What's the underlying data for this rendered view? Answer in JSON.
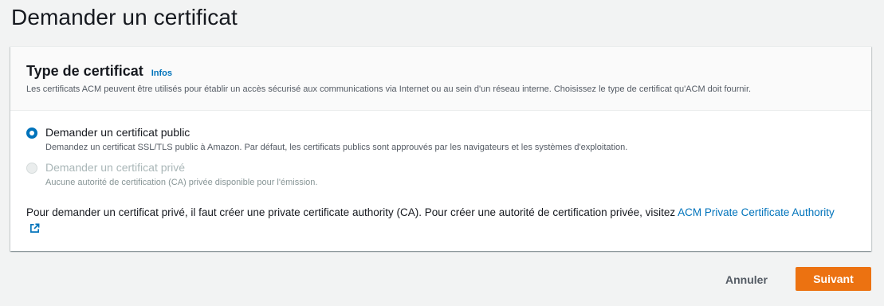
{
  "page": {
    "title": "Demander un certificat"
  },
  "certificate_type": {
    "title": "Type de certificat",
    "info_link": "Infos",
    "description": "Les certificats ACM peuvent être utilisés pour établir un accès sécurisé aux communications via Internet ou au sein d'un réseau interne. Choisissez le type de certificat qu'ACM doit fournir.",
    "options": [
      {
        "label": "Demander un certificat public",
        "description": "Demandez un certificat SSL/TLS public à Amazon. Par défaut, les certificats publics sont approuvés par les navigateurs et les systèmes d'exploitation.",
        "selected": true,
        "disabled": false
      },
      {
        "label": "Demander un certificat privé",
        "description": "Aucune autorité de certification (CA) privée disponible pour l'émission.",
        "selected": false,
        "disabled": true
      }
    ],
    "note_text": "Pour demander un certificat privé, il faut créer une private certificate authority (CA). Pour créer une autorité de certification privée, visitez ",
    "note_link": "ACM Private Certificate Authority"
  },
  "actions": {
    "cancel_label": "Annuler",
    "next_label": "Suivant"
  },
  "colors": {
    "accent": "#0073bb",
    "primary_button": "#ec7211"
  },
  "icons": {
    "external_link": "external-link-icon"
  }
}
